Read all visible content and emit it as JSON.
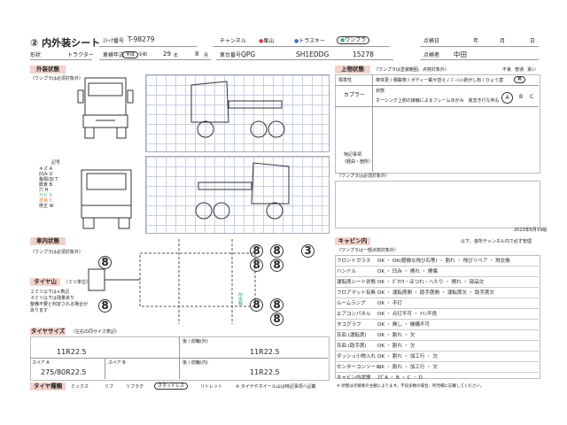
{
  "header": {
    "title": "② 内外装シート",
    "stock_no_label": "ｽﾄｯｸ番号",
    "stock_no": "T-98279",
    "channel_label": "チャンネル",
    "channels": [
      "栗山",
      "トラスキー",
      "ワンプラ"
    ],
    "inspection_date_label": "点検日",
    "year": "年",
    "month": "月",
    "day": "日",
    "shape_label": "形状",
    "shape": "トラクター",
    "reg_year_label": "車検年式",
    "era_options": [
      "平成",
      "令和"
    ],
    "reg_year_value": "29",
    "year_unit": "年",
    "reg_month_value": "8",
    "month_unit": "月",
    "model_label": "車台番号",
    "model_prefix": "QPG",
    "model_code": "SH1EDDG",
    "model_no": "15278",
    "inspector_label": "点検者",
    "inspector": "中田"
  },
  "exterior": {
    "label": "外装状態",
    "note": "（ワンプラは必須対象外）",
    "legend_title": "記号",
    "legend": [
      {
        "name": "キズ",
        "code": "A"
      },
      {
        "name": "凹み",
        "code": "U"
      },
      {
        "name": "亀裂/割",
        "code": "T"
      },
      {
        "name": "腐食",
        "code": "B"
      },
      {
        "name": "穴",
        "code": "H"
      },
      {
        "name": "サビ",
        "code": "S"
      },
      {
        "name": "塗装",
        "code": "C"
      },
      {
        "name": "修正",
        "code": "W"
      }
    ]
  },
  "top_status": {
    "label": "上物状態",
    "note": "（ワンプラは塗装範囲、点検対象外）",
    "standard_label": "標準",
    "col_headers": [
      "不良",
      "普通",
      "良い"
    ],
    "rows": [
      {
        "label": "標準性",
        "text": "車体更 / 積載物 / ボディー載せ替え / ｺﾞｰｼｮﾝ剥がし有 / ひょう害",
        "mark": "無"
      },
      {
        "label": "カプラー",
        "text": "状態",
        "grades": [
          "A",
          "B",
          "C"
        ]
      }
    ],
    "coupler_note": "ホーシング上側の接触によるフレームゆがみ　底支き行な判も",
    "special_label": "特記事項",
    "special_sub": "（経由・箇所）",
    "special_note": "（ワンプラは必須対象外）",
    "footer_code": "2023年6月19版"
  },
  "interior": {
    "label": "車内状態",
    "note": "（ワンプラは必須対象外）"
  },
  "tire_depth": {
    "label": "タイヤ山",
    "unit_note": "（ミリ単位）",
    "note_lines": [
      "２ミリ以下は×表記",
      "４ミリ以下は残量あり",
      "整備不要と判定される場合が",
      "あります"
    ],
    "values": [
      "8",
      "8",
      "8",
      "8",
      "8",
      "8",
      "8",
      "8",
      "8",
      "3"
    ]
  },
  "tire_size": {
    "label": "タイヤサイズ",
    "note": "（左右の同サイズ表記）",
    "front_label": "前 / 前輪(内)",
    "front_out_label": "後 / 前輪(外)",
    "rear_label": "前 / 前輪(外)",
    "rear_out_label": "後 / 前輪(内)",
    "front_value": "11R22.5",
    "front_right": "11R22.5",
    "rear_value": "11R22.5",
    "spare_a_label": "スペア A",
    "spare_a": "275/80R22.5",
    "spare_b_label": "スペア B",
    "rear_left": "11R22.5"
  },
  "tire_type": {
    "label": "タイヤ種類",
    "options": [
      "ミックス",
      "リブ",
      "リブラグ",
      "スタッドレス",
      "リトレット"
    ],
    "selected": "スタッドレス",
    "wheel_note": "※ タイヤやホイール山は特記事項へ記載"
  },
  "cabin": {
    "label": "キャビン内",
    "note": "（ワンプラは一部点検対象外）",
    "header_note": "以下、各所チャンネル内で必ず管理",
    "rows": [
      {
        "label": "フロントガラス",
        "opts": "OK ・ OK(軽微な飛び石等) ・ 割れ ・ 飛びリペア ・ 飛交換"
      },
      {
        "label": "ハンドル",
        "opts": "OK ・ 凹み ・ 擦れ ・ 擦傷"
      },
      {
        "label": "運転席シート状態",
        "opts": "OK ・ ｶﾞﾀﾂｷ・ほつれ・ヘたり ・ 擦れ ・ 部品欠"
      },
      {
        "label": "フロアマット有無",
        "opts": "OK ・ 運転席側 ・ 助手席側 ・ 運転席欠 ・ 助手席欠"
      },
      {
        "label": "ルームランプ",
        "opts": "OK ・ 不灯"
      },
      {
        "label": "エアコンパネル",
        "opts": "OK ・ 点灯不可 ・ ﾒｲﾝ不良"
      },
      {
        "label": "タコグラフ",
        "opts": "OK ・ 無し ・ 機構不可"
      },
      {
        "label": "灰皿 (運転席)",
        "opts": "OK ・ 割れ ・ 欠"
      },
      {
        "label": "灰皿 (助手席)",
        "opts": "OK ・ 割れ ・ 欠"
      },
      {
        "label": "ダッシュ小物入れ",
        "opts": "OK ・ 割れ ・ 加工行 ・ 欠"
      },
      {
        "label": "センターコンソール",
        "opts": "OK ・ 割れ ・ 加工行 ・ 欠"
      },
      {
        "label": "キャビン内状態",
        "opts": "ｽｸﾞA ・ B ・ C ・ D"
      }
    ],
    "footer_note": "※ 状態は点検者の主観によります。不良多数の場合、所見欄に記載してください。"
  },
  "colors": {
    "accent_bar": "#f3d2cc",
    "grid": "#c8d0e0",
    "green_text": "#3cb371",
    "red_circle": "#d04040"
  }
}
